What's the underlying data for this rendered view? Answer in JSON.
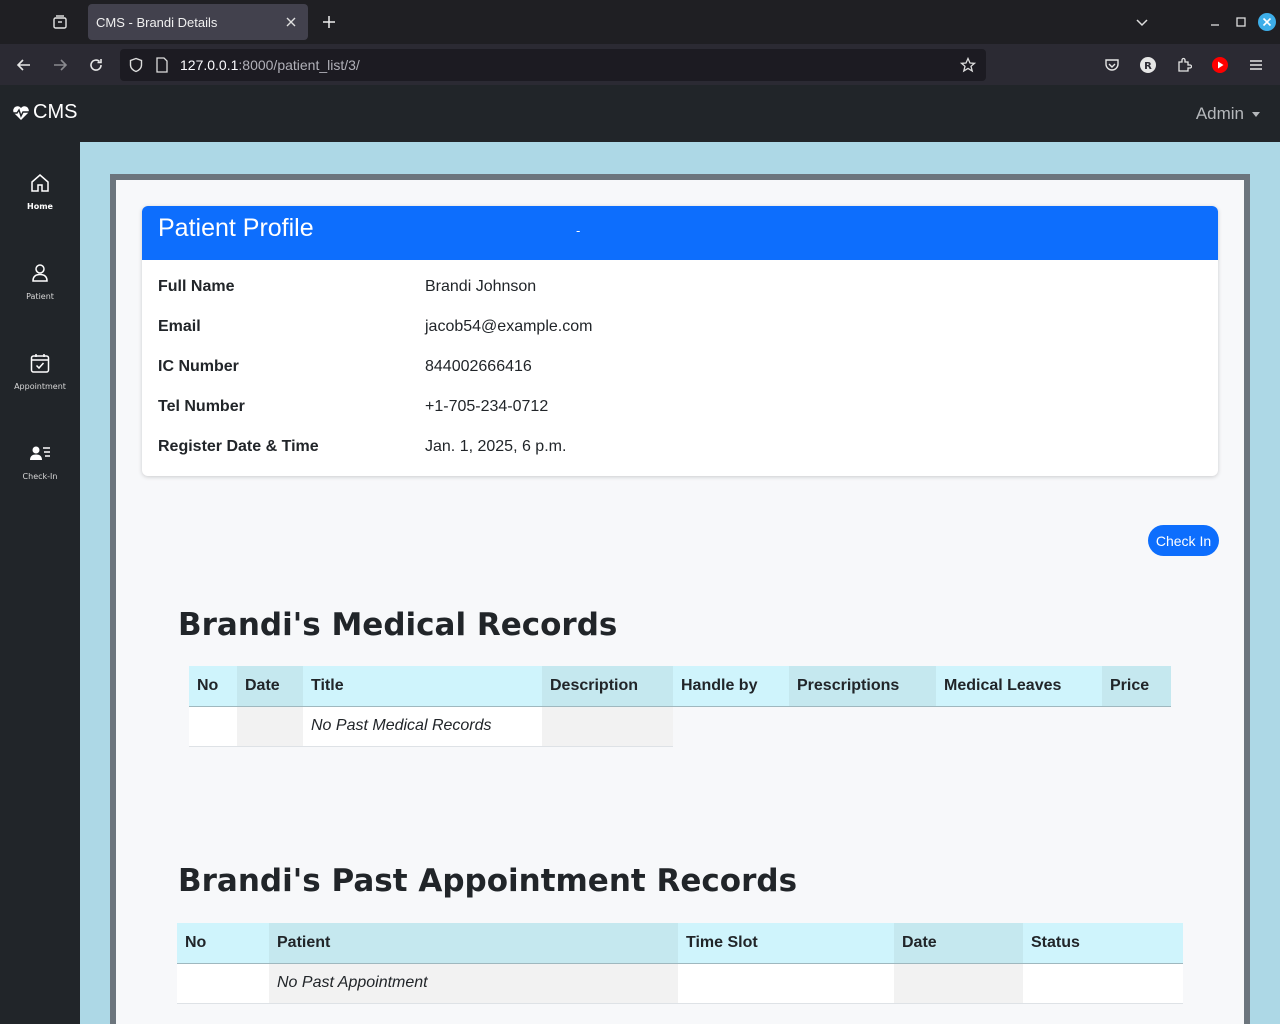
{
  "browser": {
    "tab_title": "CMS - Brandi Details",
    "url_host": "127.0.0.1",
    "url_path": ":8000/patient_list/3/"
  },
  "app": {
    "brand": "CMS",
    "user_menu": "Admin"
  },
  "sidebar": {
    "items": [
      {
        "label": "Home",
        "icon": "home-icon"
      },
      {
        "label": "Patient",
        "icon": "person-icon"
      },
      {
        "label": "Appointment",
        "icon": "calendar-check-icon"
      },
      {
        "label": "Check-In",
        "icon": "person-lines-icon"
      }
    ]
  },
  "profile": {
    "title": "Patient Profile",
    "dash": "-",
    "fields": [
      {
        "label": "Full Name",
        "value": "Brandi Johnson"
      },
      {
        "label": "Email",
        "value": "jacob54@example.com"
      },
      {
        "label": "IC Number",
        "value": "844002666416"
      },
      {
        "label": "Tel Number",
        "value": "+1-705-234-0712"
      },
      {
        "label": "Register Date & Time",
        "value": "Jan. 1, 2025, 6 p.m."
      }
    ]
  },
  "checkin_button": "Check In",
  "medical": {
    "title": "Brandi's Medical Records",
    "columns": [
      "No",
      "Date",
      "Title",
      "Description",
      "Handle by",
      "Prescriptions",
      "Medical Leaves",
      "Price"
    ],
    "empty_text": "No Past Medical Records"
  },
  "appointments": {
    "title": "Brandi's Past Appointment Records",
    "columns": [
      "No",
      "Patient",
      "Time Slot",
      "Date",
      "Status"
    ],
    "empty_text": "No Past Appointment"
  },
  "colors": {
    "primary": "#0d6efd",
    "sidebar": "#212529",
    "page_bg": "#add8e6",
    "table_header": "#cff4fc"
  }
}
